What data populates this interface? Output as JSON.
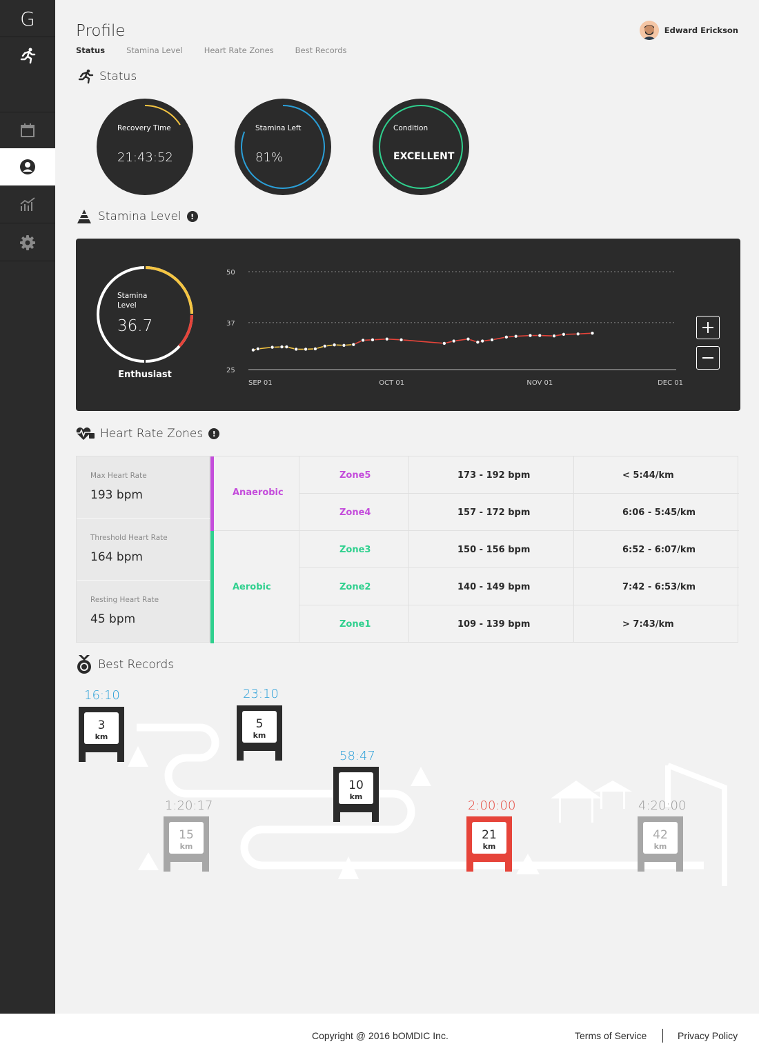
{
  "app": {
    "logo": "G"
  },
  "sidebar": {
    "items": [
      {
        "name": "runner",
        "icon": "runner-icon"
      },
      {
        "name": "calendar",
        "icon": "calendar-icon"
      },
      {
        "name": "profile",
        "icon": "profile-icon",
        "active": true
      },
      {
        "name": "stats",
        "icon": "chart-icon"
      },
      {
        "name": "settings",
        "icon": "gear-icon"
      }
    ]
  },
  "header": {
    "title": "Profile",
    "tabs": [
      "Status",
      "Stamina Level",
      "Heart Rate Zones",
      "Best Records"
    ],
    "active_tab": "Status",
    "user_name": "Edward Erickson"
  },
  "status": {
    "title": "Status",
    "recovery_label": "Recovery Time",
    "recovery_value": "21:43:52",
    "stamina_label": "Stamina Left",
    "stamina_value": "81%",
    "stamina_fraction": 0.81,
    "condition_label": "Condition",
    "condition_value": "EXCELLENT",
    "colors": {
      "recovery": "#f5c542",
      "stamina": "#2a9fd8",
      "condition": "#2fd08e"
    }
  },
  "stamina": {
    "title": "Stamina Level",
    "info": "!",
    "level_label": "Stamina Level",
    "level_value": "36.7",
    "rank": "Enthusiast",
    "plus": "+",
    "minus": "−"
  },
  "chart_data": {
    "type": "line",
    "x_ticks": [
      "SEP 01",
      "OCT 01",
      "NOV 01",
      "DEC 01"
    ],
    "y_ticks": [
      25,
      37,
      50
    ],
    "ylim": [
      25,
      50
    ],
    "series": [
      {
        "x": [
          1,
          2,
          5,
          7,
          8,
          10,
          12,
          14,
          16,
          18,
          20,
          22,
          24,
          26,
          29,
          32,
          41,
          43,
          46,
          48,
          49,
          51,
          54,
          56,
          59,
          61,
          64,
          66,
          69,
          72
        ],
        "y": [
          30.0,
          30.3,
          30.7,
          30.8,
          30.8,
          30.2,
          30.2,
          30.3,
          31.0,
          31.3,
          31.2,
          31.4,
          32.5,
          32.6,
          32.8,
          32.6,
          31.7,
          32.3,
          32.8,
          32.0,
          32.3,
          32.6,
          33.3,
          33.5,
          33.7,
          33.7,
          33.6,
          34.0,
          34.1,
          34.3
        ]
      }
    ],
    "colors": {
      "early": "#f5c542",
      "late": "#e6443a"
    }
  },
  "heart_rate": {
    "title": "Heart Rate Zones",
    "info": "!",
    "stats": [
      {
        "label": "Max Heart Rate",
        "value": "193 bpm"
      },
      {
        "label": "Threshold Heart Rate",
        "value": "164 bpm"
      },
      {
        "label": "Resting Heart Rate",
        "value": "45 bpm"
      }
    ],
    "types": [
      {
        "label": "Anaerobic",
        "color": "#c44ddb"
      },
      {
        "label": "Aerobic",
        "color": "#2fd08e"
      }
    ],
    "zones": [
      {
        "zone": "Zone5",
        "bpm": "173 - 192 bpm",
        "pace": "< 5:44/km",
        "color": "#c44ddb"
      },
      {
        "zone": "Zone4",
        "bpm": "157 - 172 bpm",
        "pace": "6:06 - 5:45/km",
        "color": "#c44ddb"
      },
      {
        "zone": "Zone3",
        "bpm": "150 - 156 bpm",
        "pace": "6:52 - 6:07/km",
        "color": "#2fd08e"
      },
      {
        "zone": "Zone2",
        "bpm": "140 - 149 bpm",
        "pace": "7:42 - 6:53/km",
        "color": "#2fd08e"
      },
      {
        "zone": "Zone1",
        "bpm": "109 - 139 bpm",
        "pace": "> 7:43/km",
        "color": "#2fd08e"
      }
    ]
  },
  "records": {
    "title": "Best Records",
    "unit": "km",
    "items": [
      {
        "distance": "3",
        "time": "16:10",
        "state": "done"
      },
      {
        "distance": "5",
        "time": "23:10",
        "state": "done"
      },
      {
        "distance": "10",
        "time": "58:47",
        "state": "done"
      },
      {
        "distance": "15",
        "time": "1:20:17",
        "state": "pending"
      },
      {
        "distance": "21",
        "time": "2:00:00",
        "state": "current"
      },
      {
        "distance": "42",
        "time": "4:20:00",
        "state": "pending"
      }
    ],
    "colors": {
      "done": "#2b2b2b",
      "done_time": "#2a9fd8",
      "pending": "#a7a7a7",
      "pending_time": "#9a9a9a",
      "current": "#e6443a"
    }
  },
  "footer": {
    "copyright": "Copyright @ 2016 bOMDIC Inc.",
    "terms": "Terms of Service",
    "privacy": "Privacy Policy"
  }
}
